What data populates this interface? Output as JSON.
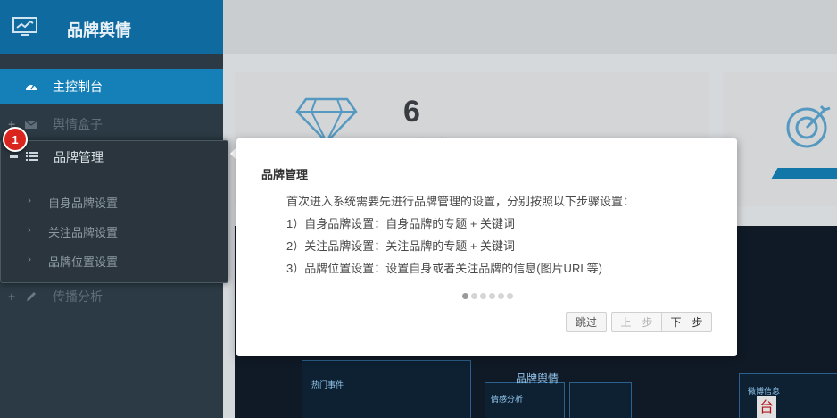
{
  "app": {
    "title": "品牌舆情"
  },
  "sidebar": {
    "items": [
      {
        "label": "主控制台",
        "icon": "dashboard-icon"
      },
      {
        "label": "舆情盒子",
        "icon": "envelope-icon"
      },
      {
        "label": "品牌管理",
        "icon": "list-icon"
      },
      {
        "label": "传播分析",
        "icon": "pencil-icon"
      }
    ],
    "brand_subitems": [
      {
        "label": "自身品牌设置"
      },
      {
        "label": "关注品牌设置"
      },
      {
        "label": "品牌位置设置"
      }
    ]
  },
  "step_badge": "1",
  "stats": {
    "brand_count": "6",
    "brand_count_label": "品牌总数"
  },
  "dashboard_preview": {
    "title": "品牌舆情",
    "panel_labels": [
      "热门事件",
      "情感分析",
      "微博信息"
    ],
    "weibo_glyph": "台"
  },
  "tour": {
    "title": "品牌管理",
    "lines": [
      "首次进入系统需要先进行品牌管理的设置，分别按照以下步骤设置：",
      "1）自身品牌设置：自身品牌的专题 + 关键词",
      "2）关注品牌设置：关注品牌的专题 + 关键词",
      "3）品牌位置设置：设置自身或者关注品牌的信息(图片URL等)"
    ],
    "step_index": 1,
    "step_total": 6,
    "buttons": {
      "skip": "跳过",
      "prev": "上一步",
      "next": "下一步"
    }
  },
  "colors": {
    "brand_blue": "#1580b8",
    "sidebar_bg": "#2b3a44",
    "badge_red": "#d9251d"
  }
}
